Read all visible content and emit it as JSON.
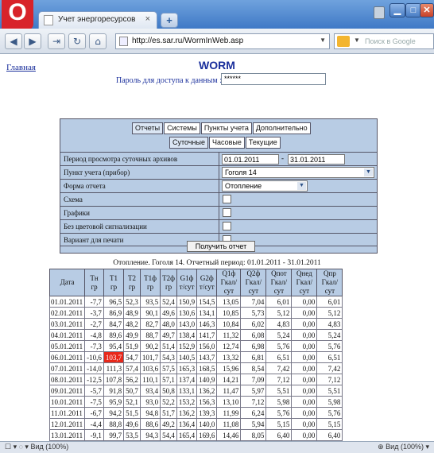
{
  "browser": {
    "logo_letter": "O",
    "tab_title": "Учет энергоресурсов",
    "tab_close": "×",
    "new_tab": "+",
    "address": "http://es.sar.ru/WormInWeb.asp",
    "search_placeholder": "Поиск в Google",
    "status_left": "☐ ▾ ◌ ▾ Вид (100%)",
    "status_right": "⊕ Вид (100%) ▾"
  },
  "page": {
    "home_link": "Главная",
    "title": "WORM",
    "password_label": "Пароль для доступа к данным :",
    "password_value": "******"
  },
  "tabs_main": [
    "Отчеты",
    "Системы",
    "Пункты учета",
    "Дополнительно"
  ],
  "tabs_sub": [
    "Суточные",
    "Часовые",
    "Текущие"
  ],
  "form": {
    "period_label": "Период просмотра суточных архивов",
    "date_from": "01.01.2011",
    "date_sep": "-",
    "date_to": "31.01.2011",
    "meter_label": "Пункт учета (прибор)",
    "meter_value": "Гоголя 14",
    "report_form_label": "Форма отчета",
    "report_form_value": "Отопление",
    "scheme_label": "Схема",
    "graphs_label": "Графики",
    "no_color_label": "Без цветовой сигнализации",
    "print_label": "Вариант для печати",
    "submit": "Получить отчет"
  },
  "report": {
    "caption": "Отопление. Гоголя 14. Отчетный период: 01.01.2011 - 31.01.2011",
    "columns": [
      "Дата",
      "Тн гр",
      "Т1 гр",
      "Т2 гр",
      "Т1ф гр",
      "Т2ф гр",
      "G1ф т/сут",
      "G2ф т/сут",
      "Q1ф Гкал/сут",
      "Q2ф Гкал/сут",
      "Qпот Гкал/сут",
      "Qнед Гкал/сут",
      "Qпр Гкал/сут"
    ],
    "rows": [
      [
        "01.01.2011",
        "-7,7",
        "96,5",
        "52,3",
        "93,5",
        "52,4",
        "150,9",
        "154,5",
        "13,05",
        "7,04",
        "6,01",
        "0,00",
        "6,01"
      ],
      [
        "02.01.2011",
        "-3,7",
        "86,9",
        "48,9",
        "90,1",
        "49,6",
        "130,6",
        "134,1",
        "10,85",
        "5,73",
        "5,12",
        "0,00",
        "5,12"
      ],
      [
        "03.01.2011",
        "-2,7",
        "84,7",
        "48,2",
        "82,7",
        "48,0",
        "143,0",
        "146,3",
        "10,84",
        "6,02",
        "4,83",
        "0,00",
        "4,83"
      ],
      [
        "04.01.2011",
        "-4,8",
        "89,6",
        "49,9",
        "88,7",
        "49,7",
        "138,4",
        "141,7",
        "11,32",
        "6,08",
        "5,24",
        "0,00",
        "5,24"
      ],
      [
        "05.01.2011",
        "-7,3",
        "95,4",
        "51,9",
        "90,2",
        "51,4",
        "152,9",
        "156,0",
        "12,74",
        "6,98",
        "5,76",
        "0,00",
        "5,76"
      ],
      [
        "06.01.2011",
        "-10,6",
        "103,7",
        "54,7",
        "101,7",
        "54,3",
        "140,5",
        "143,7",
        "13,32",
        "6,81",
        "6,51",
        "0,00",
        "6,51"
      ],
      [
        "07.01.2011",
        "-14,0",
        "111,3",
        "57,4",
        "103,6",
        "57,5",
        "165,3",
        "168,5",
        "15,96",
        "8,54",
        "7,42",
        "0,00",
        "7,42"
      ],
      [
        "08.01.2011",
        "-12,5",
        "107,8",
        "56,2",
        "110,1",
        "57,1",
        "137,4",
        "140,9",
        "14,21",
        "7,09",
        "7,12",
        "0,00",
        "7,12"
      ],
      [
        "09.01.2011",
        "-5,7",
        "91,8",
        "50,7",
        "93,4",
        "50,8",
        "133,1",
        "136,2",
        "11,47",
        "5,97",
        "5,51",
        "0,00",
        "5,51"
      ],
      [
        "10.01.2011",
        "-7,5",
        "95,9",
        "52,1",
        "93,0",
        "52,2",
        "153,2",
        "156,3",
        "13,10",
        "7,12",
        "5,98",
        "0,00",
        "5,98"
      ],
      [
        "11.01.2011",
        "-6,7",
        "94,2",
        "51,5",
        "94,8",
        "51,7",
        "136,2",
        "139,3",
        "11,99",
        "6,24",
        "5,76",
        "0,00",
        "5,76"
      ],
      [
        "12.01.2011",
        "-4,4",
        "88,8",
        "49,6",
        "88,6",
        "49,2",
        "136,4",
        "140,0",
        "11,08",
        "5,94",
        "5,15",
        "0,00",
        "5,15"
      ],
      [
        "13.01.2011",
        "-9,1",
        "99,7",
        "53,5",
        "94,3",
        "54,4",
        "165,4",
        "169,6",
        "14,46",
        "8,05",
        "6,40",
        "0,00",
        "6,40"
      ]
    ],
    "highlight_cell": {
      "row": 5,
      "col": 2,
      "color": "#e8281a"
    }
  }
}
